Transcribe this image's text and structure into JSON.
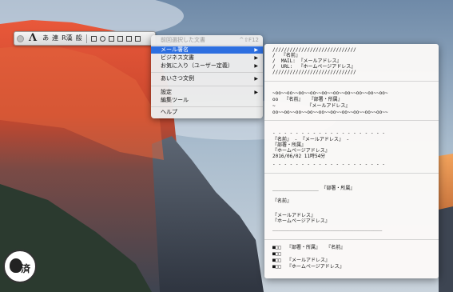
{
  "palette": {
    "logo": "Λ",
    "items": [
      "あ",
      "連",
      "R漢",
      "般"
    ]
  },
  "menu": {
    "items": [
      {
        "label": "前回選択した文書",
        "shortcut": "^⇧F12",
        "state": "disabled"
      },
      {
        "label": "メール署名",
        "arrow": "▶",
        "state": "selected"
      },
      {
        "label": "ビジネス文書",
        "arrow": "▶"
      },
      {
        "label": "お気に入り（ユーザー定義）",
        "arrow": "▶"
      },
      {
        "label": "あいさつ文例",
        "arrow": "▶"
      },
      {
        "label": "設定",
        "arrow": "▶"
      },
      {
        "label": "編集ツール"
      },
      {
        "label": "ヘルプ"
      }
    ]
  },
  "submenu": {
    "lines": [
      "/////////////////////////////",
      "/  『名前』",
      "/  MAIL: 『メールアドレス』",
      "/  URL:  『ホームページアドレス』",
      "/////////////////////////////",
      "~oo~~oo~~oo~~oo~~oo~~oo~~oo~~oo~~oo~~oo~",
      "oo  『名前』  『部署・所属』",
      "~           『メールアドレス』",
      "oo~~oo~~oo~~oo~~oo~~oo~~oo~~oo~~oo~~oo~~",
      "- - - - - - - - - - - - - - - - - - - -",
      "『名前』 - 『メールアドレス』 -",
      "『部署・所属』",
      "『ホームページアドレス』",
      "2016/06/02 11時54分",
      "- - - - - - - - - - - - - - - - - - - -",
      "________________ 『部署・所属』",
      "『名前』",
      "『メールアドレス』",
      "『ホームページアドレス』",
      "______________________________________",
      "■□□  『部署・所属』  『名前』",
      "■□□",
      "■□□  『メールアドレス』",
      "■□□  『ホームページアドレス』"
    ]
  },
  "sticker": {
    "text": "済"
  }
}
